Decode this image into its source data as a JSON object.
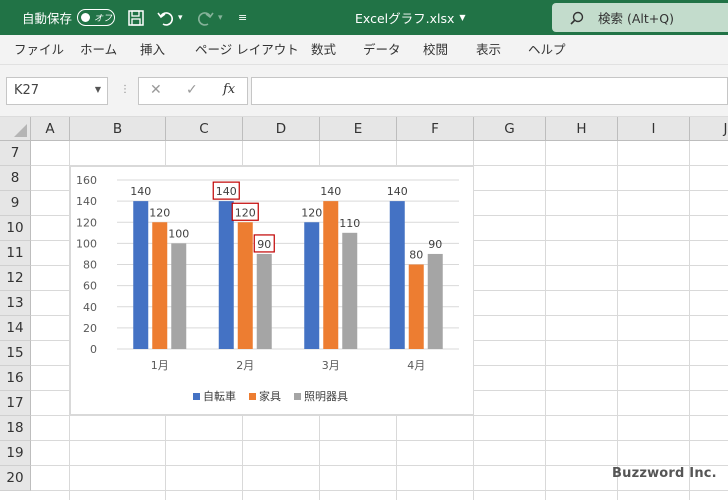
{
  "titlebar": {
    "autosave_label": "自動保存",
    "autosave_state": "オフ",
    "document_title": "Excelグラフ.xlsx",
    "search_placeholder": "検索 (Alt+Q)",
    "brand_color": "#217346"
  },
  "ribbon": {
    "tabs": [
      "ファイル",
      "ホーム",
      "挿入",
      "ページ レイアウト",
      "数式",
      "データ",
      "校閲",
      "表示",
      "ヘルプ"
    ]
  },
  "formula_bar": {
    "name_box": "K27",
    "function_label": "fx",
    "formula": ""
  },
  "grid": {
    "columns": [
      "A",
      "B",
      "C",
      "D",
      "E",
      "F",
      "G",
      "H",
      "I",
      "J"
    ],
    "rows": [
      "7",
      "8",
      "9",
      "10",
      "11",
      "12",
      "13",
      "14",
      "15",
      "16",
      "17",
      "18",
      "19",
      "20"
    ]
  },
  "chart_data": {
    "type": "bar",
    "categories": [
      "1月",
      "2月",
      "3月",
      "4月"
    ],
    "series": [
      {
        "name": "自転車",
        "values": [
          140,
          140,
          120,
          140
        ],
        "color": "#4472c4"
      },
      {
        "name": "家具",
        "values": [
          120,
          120,
          140,
          80
        ],
        "color": "#ed7d31"
      },
      {
        "name": "照明器具",
        "values": [
          100,
          90,
          110,
          90
        ],
        "color": "#a5a5a5"
      }
    ],
    "ylim": [
      0,
      160
    ],
    "yticks": [
      0,
      20,
      40,
      60,
      80,
      100,
      120,
      140,
      160
    ],
    "grid": true,
    "legend_position": "bottom",
    "data_labels": true
  },
  "watermark": "Buzzword Inc."
}
